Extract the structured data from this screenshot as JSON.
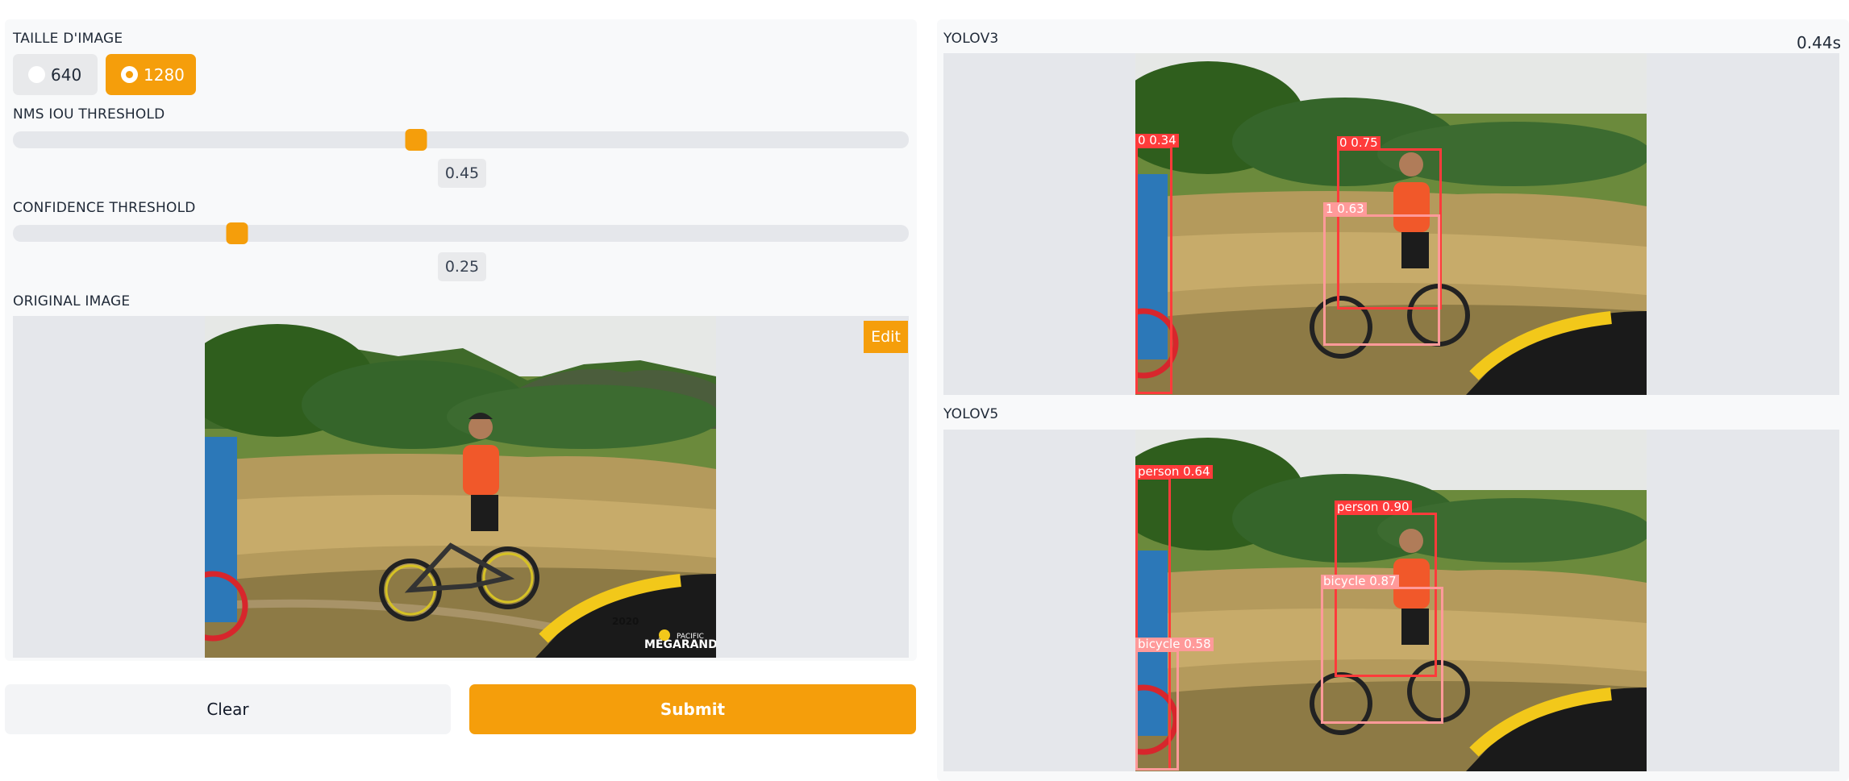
{
  "left": {
    "image_size": {
      "label": "TAILLE D'IMAGE",
      "options": [
        "640",
        "1280"
      ],
      "selected": "1280"
    },
    "nms": {
      "label": "NMS IOU THRESHOLD",
      "value": "0.45",
      "fraction": 0.45
    },
    "confidence": {
      "label": "CONFIDENCE THRESHOLD",
      "value": "0.25",
      "fraction": 0.25
    },
    "original": {
      "label": "ORIGINAL IMAGE",
      "edit_label": "Edit",
      "watermark_year": "2020",
      "watermark_brand": "MÉGARANDO",
      "watermark_sponsor": "PACIFIC"
    },
    "clear_label": "Clear",
    "submit_label": "Submit"
  },
  "right": {
    "yolov3": {
      "label": "YOLOV3",
      "time": "0.44s",
      "detections": [
        {
          "text": "0  0.34",
          "color": "#ff3b3b"
        },
        {
          "text": "0  0.75",
          "color": "#ff3b3b"
        },
        {
          "text": "1  0.63",
          "color": "#ff9a9a"
        }
      ]
    },
    "yolov5": {
      "label": "YOLOV5",
      "detections": [
        {
          "text": "person  0.64",
          "color": "#ff3b3b"
        },
        {
          "text": "person  0.90",
          "color": "#ff3b3b"
        },
        {
          "text": "bicycle  0.87",
          "color": "#ff9a9a"
        },
        {
          "text": "bicycle  0.58",
          "color": "#ff9a9a"
        }
      ]
    }
  },
  "colors": {
    "accent": "#f59e0b",
    "panel": "#f8f9fa",
    "imagebg": "#e5e7eb"
  }
}
